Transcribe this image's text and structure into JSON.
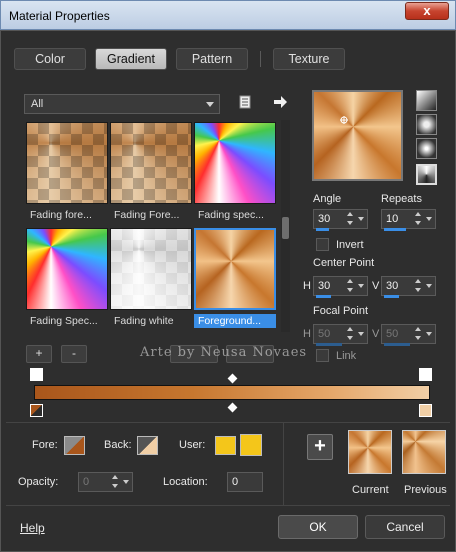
{
  "window": {
    "title": "Material Properties",
    "close_label": "x"
  },
  "tabs": [
    {
      "label": "Color"
    },
    {
      "label": "Gradient"
    },
    {
      "label": "Pattern"
    },
    {
      "label": "Texture"
    }
  ],
  "filter": {
    "value": "All"
  },
  "swatches": [
    {
      "label": "Fading fore..."
    },
    {
      "label": "Fading Fore..."
    },
    {
      "label": "Fading spec..."
    },
    {
      "label": "Fading Spec..."
    },
    {
      "label": "Fading white"
    },
    {
      "label": "Foreground..."
    }
  ],
  "list_buttons": {
    "add": "+",
    "remove": "-"
  },
  "watermark": "Arte by Neusa Novaes",
  "angle": {
    "label": "Angle",
    "value": "30"
  },
  "repeats": {
    "label": "Repeats",
    "value": "10"
  },
  "invert": {
    "label": "Invert"
  },
  "center_point": {
    "label": "Center Point",
    "h_label": "H",
    "h": "30",
    "v_label": "V",
    "v": "30"
  },
  "focal_point": {
    "label": "Focal Point",
    "h_label": "H",
    "h": "50",
    "v_label": "V",
    "v": "50"
  },
  "link": {
    "label": "Link"
  },
  "colors": {
    "fore_label": "Fore:",
    "back_label": "Back:",
    "user_label": "User:",
    "user_swatch_1": "#f4c61a",
    "user_swatch_2": "#f4c61a"
  },
  "opacity": {
    "label": "Opacity:",
    "value": "0"
  },
  "location": {
    "label": "Location:",
    "value": "0"
  },
  "add_button": "+",
  "current_label": "Current",
  "previous_label": "Previous",
  "help_label": "Help",
  "ok_label": "OK",
  "cancel_label": "Cancel"
}
